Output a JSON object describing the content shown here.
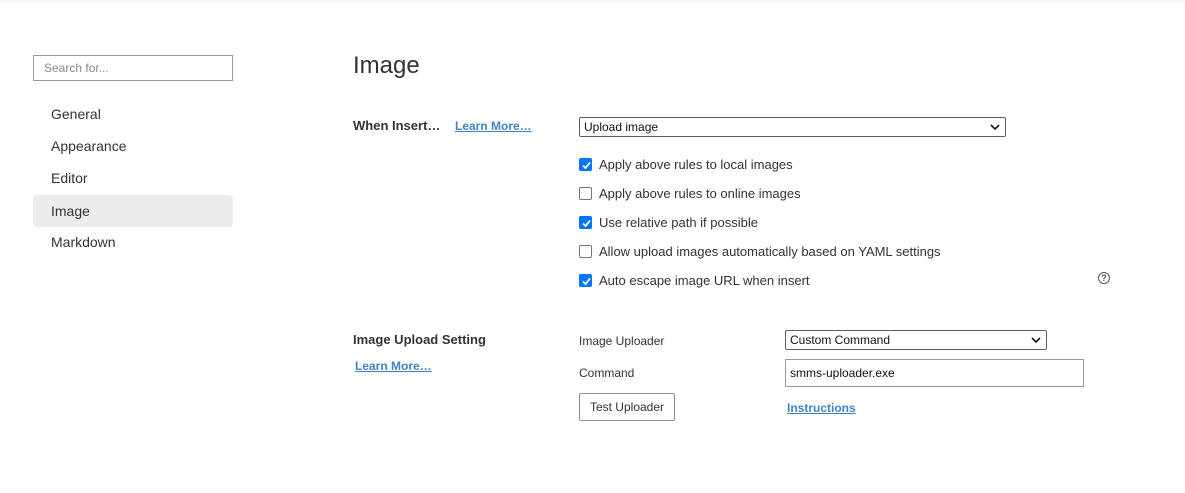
{
  "sidebar": {
    "search_placeholder": "Search for...",
    "items": [
      {
        "label": "General"
      },
      {
        "label": "Appearance"
      },
      {
        "label": "Editor"
      },
      {
        "label": "Image",
        "active": true
      },
      {
        "label": "Markdown"
      }
    ]
  },
  "main": {
    "title": "Image",
    "when_insert": {
      "label": "When Insert…",
      "learn_more": "Learn More…",
      "select_value": "Upload image",
      "options": [
        {
          "label": "Apply above rules to local images",
          "checked": true
        },
        {
          "label": "Apply above rules to online images",
          "checked": false
        },
        {
          "label": "Use relative path if possible",
          "checked": true
        },
        {
          "label": "Allow upload images automatically based on YAML settings",
          "checked": false
        },
        {
          "label": "Auto escape image URL when insert",
          "checked": true
        }
      ],
      "help_glyph": "?"
    },
    "upload_setting": {
      "label": "Image Upload Setting",
      "learn_more": "Learn More…",
      "uploader_label": "Image Uploader",
      "uploader_value": "Custom Command",
      "command_label": "Command",
      "command_value": "smms-uploader.exe",
      "test_button": "Test Uploader",
      "instructions": "Instructions"
    }
  },
  "colors": {
    "accent": "#0075ff",
    "link": "#4183c4",
    "active_nav_bg": "#ededed"
  }
}
